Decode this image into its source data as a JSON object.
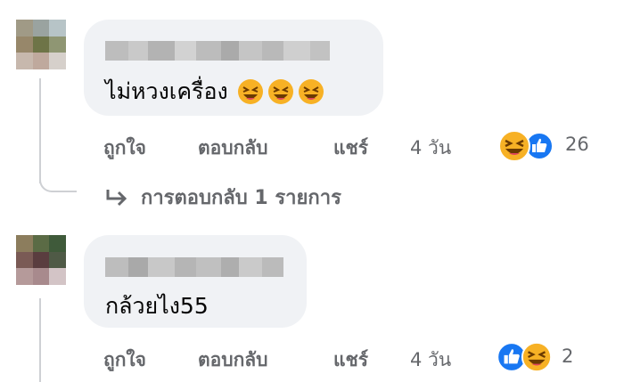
{
  "comments": [
    {
      "text": "ไม่หวงเครื่อง",
      "emojis": [
        "grinning-squinting-face",
        "grinning-squinting-face",
        "grinning-squinting-face"
      ],
      "actions": {
        "like": "ถูกใจ",
        "reply": "ตอบกลับ",
        "share": "แชร์",
        "time": "4 วัน"
      },
      "reactions": [
        "haha",
        "like"
      ],
      "reaction_count": "26",
      "view_replies": "การตอบกลับ 1 รายการ",
      "avatar_colors": [
        "#a09a86",
        "#9aa3a0",
        "#b7c4c7",
        "#97876a",
        "#6e7447",
        "#8f9673",
        "#c7b8ad",
        "#bfa99d",
        "#d6d0cb"
      ],
      "name_blur_colors": [
        "#bdbdbd",
        "#c9c9c9",
        "#b3b3b3",
        "#d2d2d2",
        "#bcbcbc",
        "#aaaaaa",
        "#c5c5c5",
        "#b9b9b9",
        "#cfcfcf",
        "#c2c2c2"
      ]
    },
    {
      "text": "กล้วยไง55",
      "actions": {
        "like": "ถูกใจ",
        "reply": "ตอบกลับ",
        "share": "แชร์",
        "time": "4 วัน"
      },
      "reactions": [
        "like",
        "haha"
      ],
      "reaction_count": "2",
      "avatar_colors": [
        "#8c7d5d",
        "#5b6b45",
        "#3f5a3a",
        "#7a5a55",
        "#5a3d3f",
        "#4f5a46",
        "#b59a9a",
        "#a88a8d",
        "#d3c4c6"
      ],
      "name_blur_colors": [
        "#bdbdbd",
        "#a9a9a9",
        "#c8c8c8",
        "#b5b5b5",
        "#c0c0c0",
        "#aeaeae",
        "#cacaca",
        "#bbbbbb"
      ]
    }
  ],
  "colors": {
    "bubble": "#f0f2f5",
    "secondary_text": "#65676b",
    "like_blue": "#1877f2",
    "haha_yellow": "#f7b125"
  }
}
